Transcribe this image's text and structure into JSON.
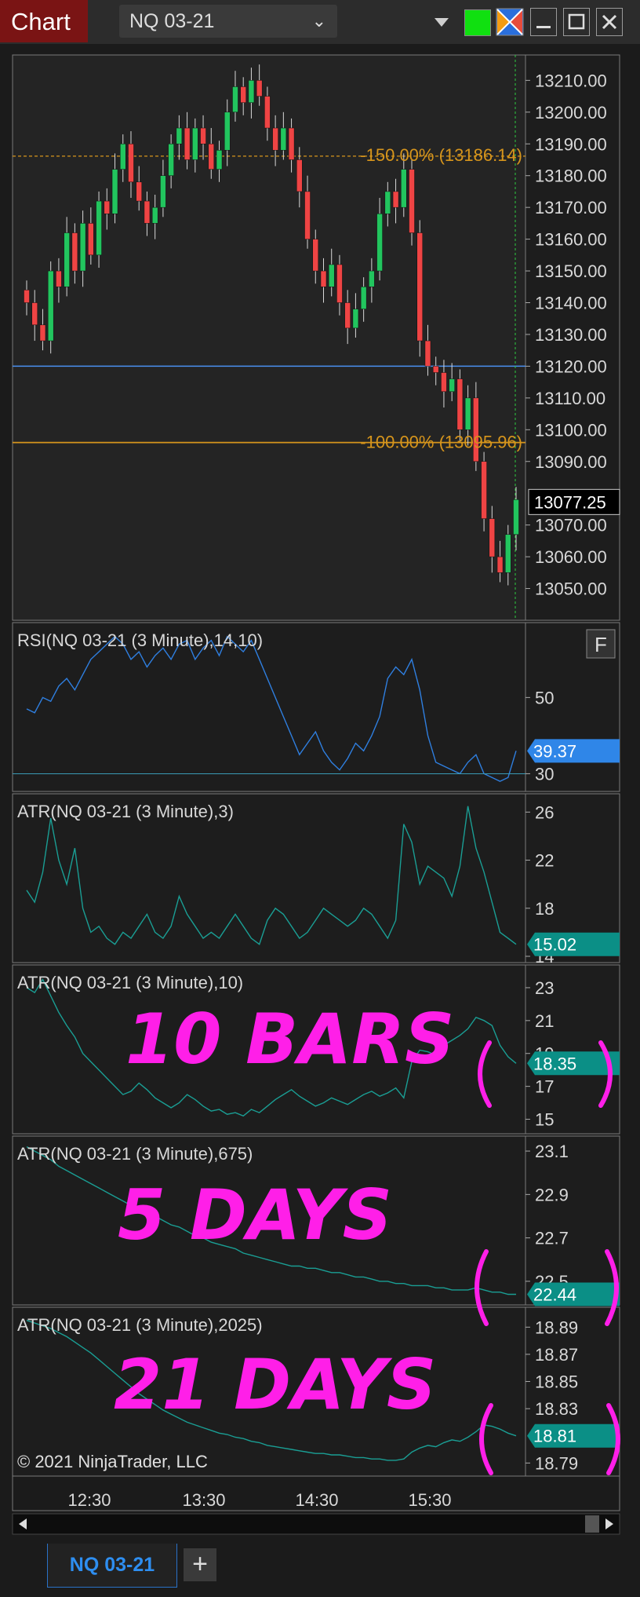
{
  "titlebar": {
    "window_label": "Chart",
    "instrument": "NQ 03-21"
  },
  "tabs": {
    "active": "NQ 03-21",
    "add_label": "+"
  },
  "copyright": "© 2021 NinjaTrader, LLC",
  "price_panel": {
    "current_price": "13077.25",
    "fib_upper_label": "-150.00% (13186.14)",
    "fib_lower_label": "-100.00% (13095.96)",
    "hline_blue": 13120,
    "hline_fib_upper": 13186.14,
    "hline_fib_lower": 13095.96,
    "ticks": [
      "13210.00",
      "13200.00",
      "13190.00",
      "13180.00",
      "13170.00",
      "13160.00",
      "13150.00",
      "13140.00",
      "13130.00",
      "13120.00",
      "13110.00",
      "13100.00",
      "13090.00",
      "13070.00",
      "13060.00",
      "13050.00"
    ]
  },
  "colors": {
    "up": "#22c55e",
    "down": "#ef4444",
    "rsi": "#2f7fe0",
    "atr": "#1a9e94",
    "fib": "#d6951c",
    "blue_line": "#4a8ff0",
    "annot": "#ff1fe8",
    "text": "#d8d8d8"
  },
  "rsi_panel": {
    "label": "RSI(NQ 03-21 (3 Minute),14,10)",
    "value": "39.37",
    "button": "F",
    "ticks": [
      "50",
      "30"
    ]
  },
  "atr3_panel": {
    "label": "ATR(NQ 03-21 (3 Minute),3)",
    "value": "15.02",
    "ticks": [
      "26",
      "22",
      "18",
      "14"
    ]
  },
  "atr10_panel": {
    "label": "ATR(NQ 03-21 (3 Minute),10)",
    "value": "18.35",
    "ticks": [
      "23",
      "21",
      "19",
      "17",
      "15"
    ],
    "annotation": "10 BARS"
  },
  "atr675_panel": {
    "label": "ATR(NQ 03-21 (3 Minute),675)",
    "value": "22.44",
    "ticks": [
      "23.1",
      "22.9",
      "22.7",
      "22.5"
    ],
    "annotation": "5 DAYS"
  },
  "atr2025_panel": {
    "label": "ATR(NQ 03-21 (3 Minute),2025)",
    "value": "18.81",
    "ticks": [
      "18.89",
      "18.87",
      "18.85",
      "18.83",
      "18.79"
    ],
    "annotation": "21 DAYS"
  },
  "time_axis": [
    "12:30",
    "13:30",
    "14:30",
    "15:30"
  ],
  "chart_data": [
    {
      "type": "candlestick",
      "title": "NQ 03-21 (3 Minute)",
      "ylim": [
        13040,
        13218
      ],
      "x_labels": [
        "12:30",
        "13:30",
        "14:30",
        "15:30"
      ],
      "close": [
        13140,
        13133,
        13128,
        13150,
        13145,
        13162,
        13150,
        13165,
        13155,
        13172,
        13168,
        13182,
        13190,
        13178,
        13172,
        13165,
        13170,
        13180,
        13190,
        13195,
        13185,
        13195,
        13190,
        13182,
        13188,
        13200,
        13208,
        13203,
        13210,
        13205,
        13195,
        13188,
        13195,
        13185,
        13175,
        13160,
        13150,
        13145,
        13152,
        13140,
        13132,
        13138,
        13145,
        13150,
        13168,
        13175,
        13170,
        13182,
        13162,
        13128,
        13120,
        13118,
        13112,
        13116,
        13100,
        13110,
        13090,
        13072,
        13060,
        13055,
        13067,
        13078
      ],
      "current_price": 13077.25
    },
    {
      "type": "line",
      "name": "RSI 14",
      "ylim": [
        27,
        68
      ],
      "values": [
        47,
        46,
        50,
        49,
        53,
        55,
        52,
        56,
        60,
        62,
        64,
        66,
        64,
        60,
        62,
        58,
        61,
        63,
        60,
        64,
        65,
        60,
        63,
        65,
        61,
        66,
        64,
        62,
        65,
        60,
        55,
        50,
        45,
        40,
        35,
        38,
        41,
        36,
        33,
        31,
        34,
        38,
        36,
        40,
        45,
        55,
        58,
        56,
        60,
        52,
        40,
        33,
        32,
        31,
        30,
        33,
        35,
        30,
        29,
        28,
        29,
        36
      ]
    },
    {
      "type": "line",
      "name": "ATR 3",
      "ylim": [
        14,
        27
      ],
      "values": [
        19.5,
        18.5,
        21,
        25.5,
        22,
        20,
        23,
        18,
        16,
        16.5,
        15.5,
        15,
        16,
        15.5,
        16.5,
        17.5,
        16,
        15.5,
        16.5,
        19,
        17.5,
        16.5,
        15.5,
        16,
        15.5,
        16.5,
        17.5,
        16.5,
        15.5,
        15,
        17,
        18,
        17.5,
        16.5,
        15.5,
        16,
        17,
        18,
        17.5,
        17,
        16.5,
        17,
        18,
        17.5,
        16.5,
        15.5,
        17,
        25,
        23.5,
        20,
        21.5,
        21,
        20.5,
        19,
        21.5,
        26.5,
        23,
        21,
        18.5,
        16,
        15.5,
        15
      ]
    },
    {
      "type": "line",
      "name": "ATR 10",
      "ylim": [
        14.5,
        24
      ],
      "values": [
        23,
        22.7,
        23.5,
        22.5,
        21.5,
        20.7,
        20,
        19,
        18.5,
        18,
        17.5,
        17,
        16.5,
        16.7,
        17.2,
        16.8,
        16.3,
        16,
        15.7,
        16,
        16.5,
        16.2,
        15.8,
        15.5,
        15.6,
        15.3,
        15.4,
        15.2,
        15.6,
        15.4,
        15.8,
        16.2,
        16.5,
        16.8,
        16.4,
        16.1,
        15.8,
        16,
        16.3,
        16.1,
        15.9,
        16.2,
        16.5,
        16.7,
        16.4,
        16.6,
        16.9,
        16.3,
        18.5,
        19.2,
        19.1,
        18.9,
        19.5,
        19.8,
        20.1,
        20.5,
        21.2,
        21,
        20.7,
        19.5,
        18.8,
        18.4
      ]
    },
    {
      "type": "line",
      "name": "ATR 675",
      "ylim": [
        22.42,
        23.14
      ],
      "values": [
        23.12,
        23.1,
        23.08,
        23.06,
        23.03,
        23.01,
        22.99,
        22.97,
        22.95,
        22.93,
        22.91,
        22.89,
        22.87,
        22.85,
        22.84,
        22.82,
        22.8,
        22.78,
        22.76,
        22.75,
        22.73,
        22.71,
        22.7,
        22.68,
        22.67,
        22.66,
        22.65,
        22.63,
        22.62,
        22.61,
        22.6,
        22.59,
        22.58,
        22.57,
        22.57,
        22.56,
        22.56,
        22.55,
        22.54,
        22.54,
        22.53,
        22.52,
        22.52,
        22.51,
        22.5,
        22.5,
        22.49,
        22.49,
        22.48,
        22.48,
        22.48,
        22.47,
        22.47,
        22.46,
        22.46,
        22.46,
        22.47,
        22.46,
        22.45,
        22.45,
        22.44,
        22.44
      ]
    },
    {
      "type": "line",
      "name": "ATR 2025",
      "ylim": [
        18.785,
        18.9
      ],
      "values": [
        18.895,
        18.893,
        18.891,
        18.889,
        18.886,
        18.883,
        18.879,
        18.875,
        18.871,
        18.866,
        18.861,
        18.856,
        18.851,
        18.846,
        18.841,
        18.837,
        18.833,
        18.829,
        18.826,
        18.823,
        18.82,
        18.818,
        18.816,
        18.814,
        18.812,
        18.811,
        18.809,
        18.808,
        18.806,
        18.805,
        18.803,
        18.802,
        18.801,
        18.8,
        18.799,
        18.798,
        18.797,
        18.797,
        18.796,
        18.796,
        18.795,
        18.794,
        18.794,
        18.793,
        18.793,
        18.792,
        18.792,
        18.793,
        18.798,
        18.801,
        18.803,
        18.802,
        18.805,
        18.807,
        18.806,
        18.809,
        18.813,
        18.818,
        18.817,
        18.815,
        18.812,
        18.81
      ]
    }
  ]
}
